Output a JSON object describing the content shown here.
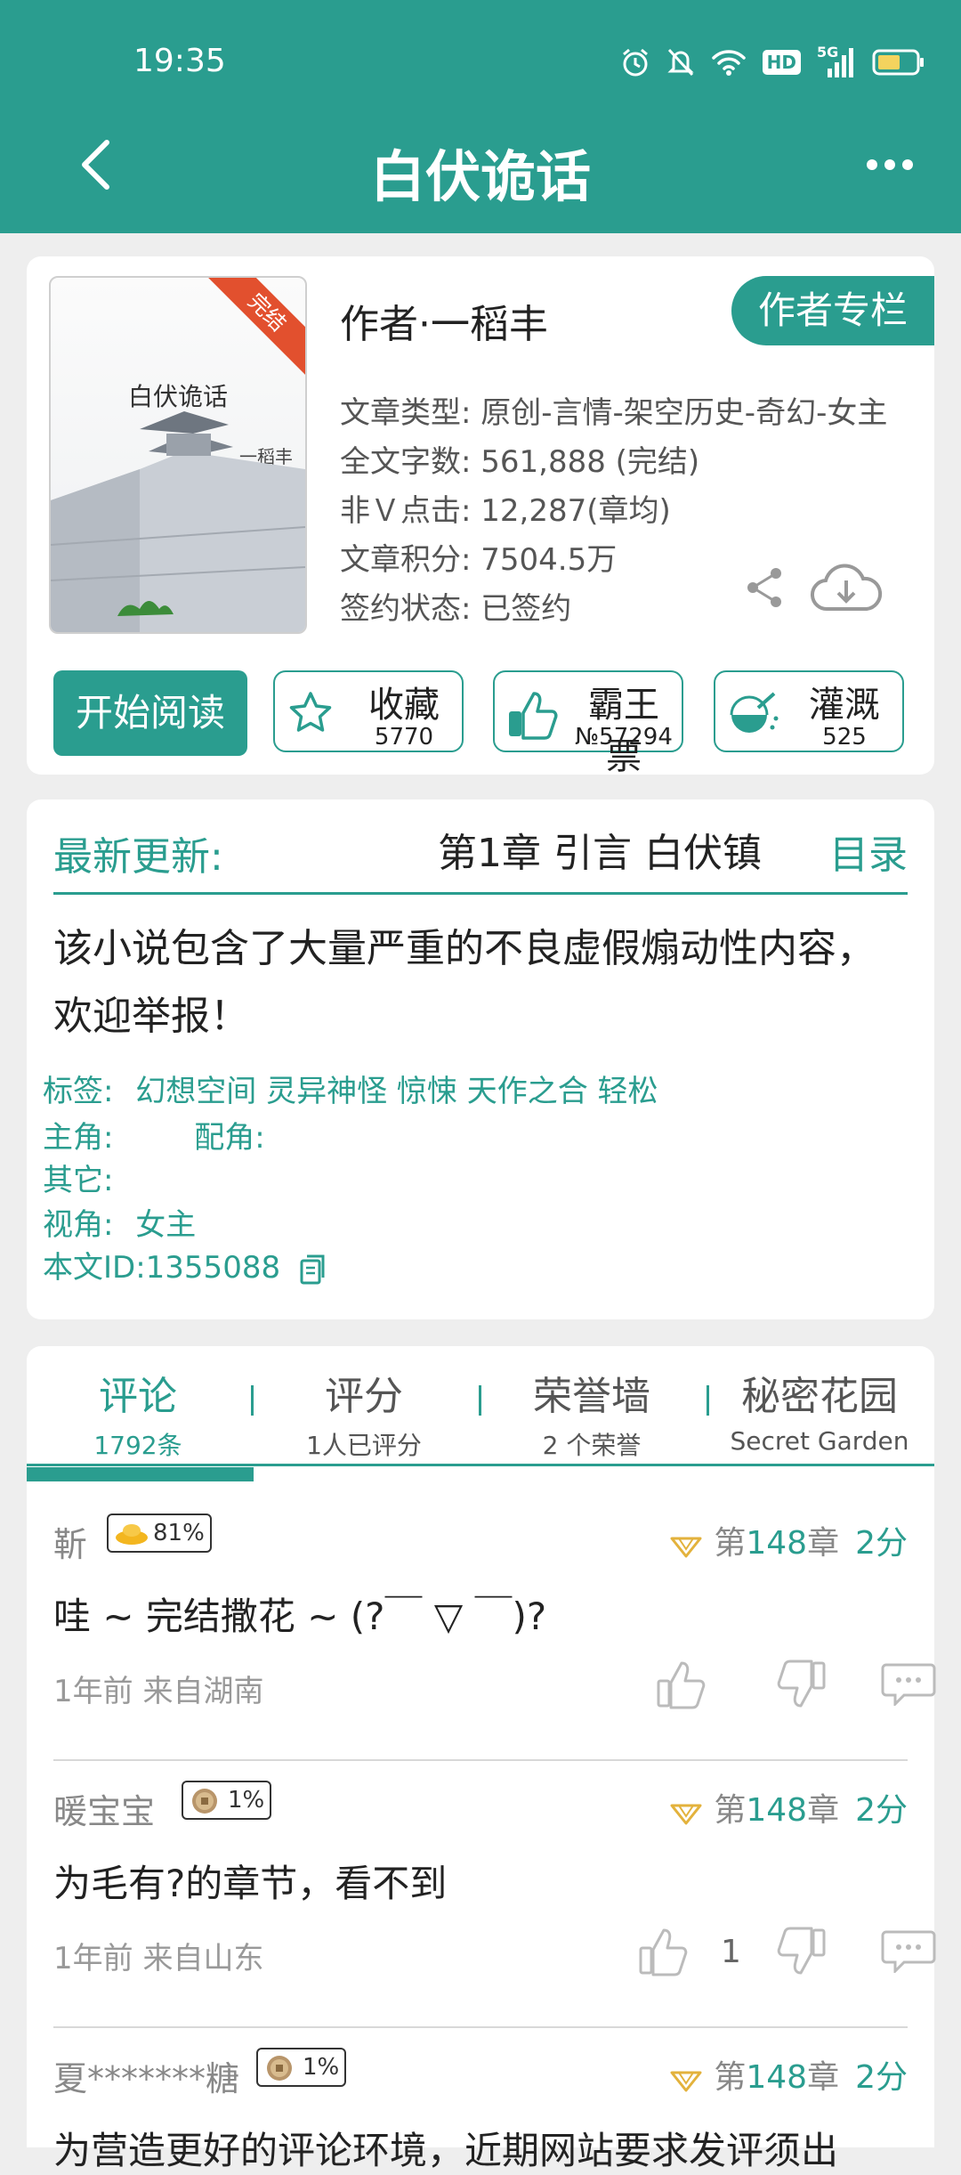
{
  "status_bar": {
    "time": "19:35",
    "network": "5G",
    "hd": "HD"
  },
  "header": {
    "title": "白伏诡话"
  },
  "book": {
    "cover_title": "白伏诡话",
    "cover_author": "一稻丰",
    "cover_ribbon": "完结",
    "author_line": "作者·一稻丰",
    "author_column_button": "作者专栏",
    "meta": [
      "文章类型: 原创-言情-架空历史-奇幻-女主",
      "全文字数: 561,888 (完结)",
      "非Ｖ点击: 12,287(章均)",
      "文章积分: 7504.5万",
      "签约状态: 已签约"
    ],
    "read_button": "开始阅读",
    "actions": [
      {
        "label": "收藏",
        "count": "5770",
        "icon": "star-icon"
      },
      {
        "label": "霸王票",
        "count": "№57294",
        "icon": "thumbs-up-icon"
      },
      {
        "label": "灌溉",
        "count": "525",
        "icon": "watering-icon"
      }
    ]
  },
  "update": {
    "label": "最新更新:",
    "chapter": "第1章  引言 白伏镇",
    "toc": "目录",
    "warning": "该小说包含了大量严重的不良虚假煽动性内容，欢迎举报！",
    "tags_label": "标签:",
    "tags": "幻想空间 灵异神怪 惊悚 天作之合 轻松",
    "protagonist_label": "主角:",
    "supporting_label": "配角:",
    "other_label": "其它:",
    "pov_label": "视角:",
    "pov": "女主",
    "id_label": "本文ID:1355088"
  },
  "tabs": [
    {
      "title": "评论",
      "sub": "1792条",
      "active": true
    },
    {
      "title": "评分",
      "sub": "1人已评分"
    },
    {
      "title": "荣誉墙",
      "sub": "2 个荣誉"
    },
    {
      "title": "秘密花园",
      "sub": "Secret Garden"
    }
  ],
  "comments": [
    {
      "user": "靳",
      "badge": "81%",
      "chapter_prefix": "第",
      "chapter_num": "148",
      "chapter_suffix": "章",
      "score": "2分",
      "text": "哇 ~ 完结撒花 ~ (?￣ ▽ ￣)?",
      "meta": "1年前  来自湖南",
      "likes": ""
    },
    {
      "user": "暖宝宝",
      "badge": "1%",
      "chapter_prefix": "第",
      "chapter_num": "148",
      "chapter_suffix": "章",
      "score": "2分",
      "text": "为毛有?的章节，看不到",
      "meta": "1年前  来自山东",
      "likes": "1"
    },
    {
      "user": "夏*******糖",
      "badge": "1%",
      "chapter_prefix": "第",
      "chapter_num": "148",
      "chapter_suffix": "章",
      "score": "2分",
      "text": "为营造更好的评论环境，近期网站要求发评须出",
      "meta": "",
      "likes": ""
    }
  ],
  "colors": {
    "brand": "#2a9d8f",
    "ribbon": "#e2502e"
  }
}
